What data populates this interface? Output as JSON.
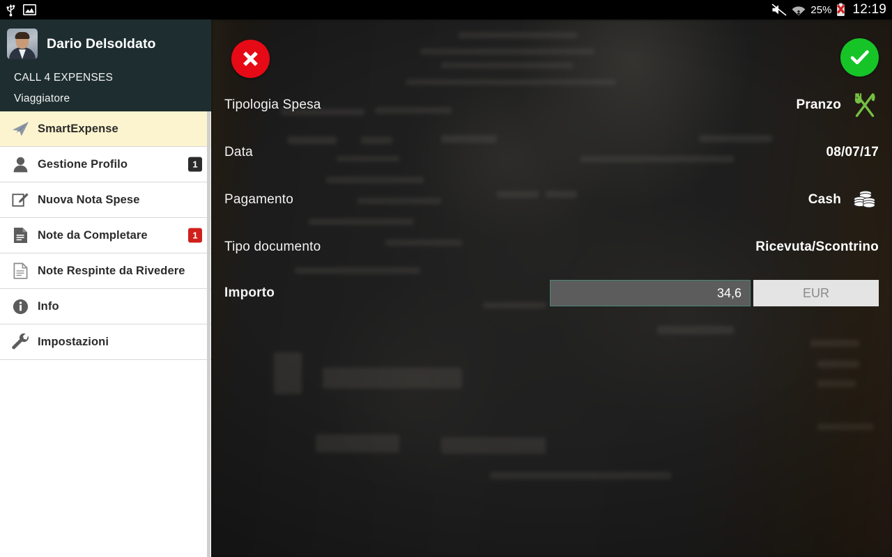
{
  "status_bar": {
    "left_icons": [
      "usb-icon",
      "screenshot-icon"
    ],
    "mute_icon": "volume-muted-icon",
    "wifi_icon": "wifi-icon",
    "battery_percent": "25%",
    "battery_icon": "battery-error-icon",
    "time": "12:19"
  },
  "sidebar": {
    "user_name": "Dario Delsoldato",
    "company": "CALL 4 EXPENSES",
    "role": "Viaggiatore",
    "items": [
      {
        "label": "SmartExpense",
        "icon": "paper-plane-icon",
        "badge": null,
        "badge_style": null,
        "active": true
      },
      {
        "label": "Gestione Profilo",
        "icon": "person-icon",
        "badge": "1",
        "badge_style": "dark",
        "active": false
      },
      {
        "label": "Nuova Nota Spese",
        "icon": "edit-note-icon",
        "badge": null,
        "badge_style": null,
        "active": false
      },
      {
        "label": "Note da Completare",
        "icon": "document-icon",
        "badge": "1",
        "badge_style": "red",
        "active": false
      },
      {
        "label": "Note Respinte da Rivedere",
        "icon": "document-outline-icon",
        "badge": null,
        "badge_style": null,
        "active": false
      },
      {
        "label": "Info",
        "icon": "info-icon",
        "badge": null,
        "badge_style": null,
        "active": false
      },
      {
        "label": "Impostazioni",
        "icon": "wrench-icon",
        "badge": null,
        "badge_style": null,
        "active": false
      }
    ]
  },
  "content": {
    "close_button": {
      "name": "close-button",
      "icon": "x-icon",
      "color": "#e60a16"
    },
    "confirm_button": {
      "name": "confirm-button",
      "icon": "check-icon",
      "color": "#16c428"
    },
    "form": {
      "expense_type": {
        "label": "Tipologia Spesa",
        "value": "Pranzo",
        "icon": "fork-knife-icon",
        "icon_color": "#76c043"
      },
      "date": {
        "label": "Data",
        "value": "08/07/17",
        "icon": null
      },
      "payment": {
        "label": "Pagamento",
        "value": "Cash",
        "icon": "coins-icon"
      },
      "document_type": {
        "label": "Tipo documento",
        "value": "Ricevuta/Scontrino",
        "icon": null
      },
      "amount": {
        "label": "Importo",
        "value": "34,6",
        "placeholder": "",
        "currency": "EUR"
      }
    }
  }
}
